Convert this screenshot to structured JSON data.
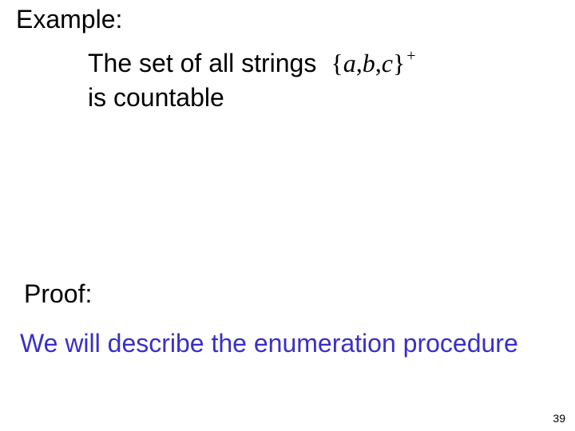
{
  "headings": {
    "example": "Example:",
    "proof": "Proof:"
  },
  "statement": {
    "line1_prefix": "The set of all strings",
    "set_open": "{",
    "set_a": "a",
    "set_sep1": ",",
    "set_b": "b",
    "set_sep2": ",",
    "set_c": "c",
    "set_close": "}",
    "set_exponent": "+",
    "line2": "is countable"
  },
  "proof_body": "We will describe the enumeration procedure",
  "page_number": "39"
}
